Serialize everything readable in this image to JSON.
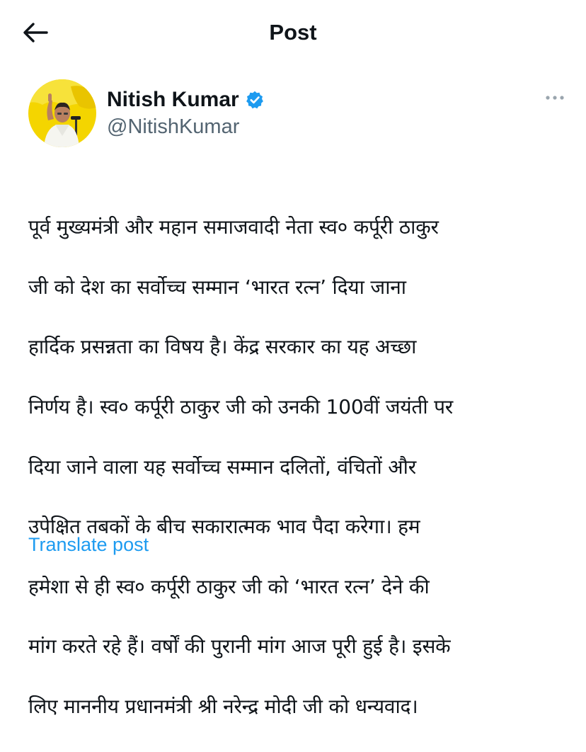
{
  "header": {
    "title": "Post",
    "back_icon": "arrow-left-icon"
  },
  "author": {
    "display_name": "Nitish Kumar",
    "handle": "@NitishKumar",
    "verified_icon": "verified-badge-icon",
    "verified_color": "#1d9bf0",
    "avatar_background": "#f2d600"
  },
  "post": {
    "text_lines": [
      "पूर्व मुख्यमंत्री और महान समाजवादी नेता स्व० कर्पूरी ठाकुर",
      "जी को देश का सर्वोच्च सम्मान ‘भारत रत्न’ दिया जाना",
      "हार्दिक प्रसन्नता का विषय है। केंद्र सरकार का यह अच्छा",
      "निर्णय है। स्व० कर्पूरी ठाकुर जी को उनकी 100वीं जयंती पर",
      "दिया जाने वाला यह सर्वोच्च सम्मान दलितों, वंचितों और",
      "उपेक्षित तबकों के बीच सकारात्मक भाव पैदा करेगा। हम",
      "हमेशा से ही स्व० कर्पूरी ठाकुर जी को ‘भारत रत्न’ देने की",
      "मांग करते रहे हैं। वर्षों की पुरानी मांग आज पूरी हुई है। इसके",
      "लिए माननीय प्रधानमंत्री श्री नरेन्द्र मोदी जी को धन्यवाद।"
    ],
    "translate_label": "Translate post",
    "more_icon": "more-horizontal-icon"
  },
  "colors": {
    "link": "#1d9bf0",
    "secondary_text": "#536471",
    "primary_text": "#0f1419"
  }
}
